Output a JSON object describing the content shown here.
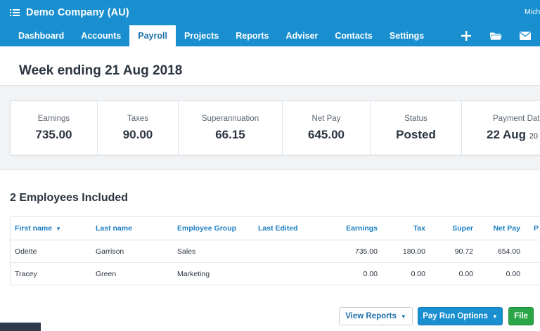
{
  "org": {
    "name": "Demo Company (AU)",
    "user": "Mich"
  },
  "nav": {
    "items": [
      "Dashboard",
      "Accounts",
      "Payroll",
      "Projects",
      "Reports",
      "Adviser",
      "Contacts",
      "Settings"
    ],
    "active": "Payroll",
    "icons": [
      "plus-icon",
      "folder-icon",
      "mail-icon"
    ]
  },
  "page": {
    "title": "Week ending 21 Aug 2018"
  },
  "summary": {
    "earnings": {
      "label": "Earnings",
      "value": "735.00"
    },
    "taxes": {
      "label": "Taxes",
      "value": "90.00"
    },
    "super": {
      "label": "Superannuation",
      "value": "66.15"
    },
    "net": {
      "label": "Net Pay",
      "value": "645.00"
    },
    "status": {
      "label": "Status",
      "value": "Posted"
    },
    "payment_date": {
      "label": "Payment Date",
      "value": "22 Aug",
      "year": "20"
    }
  },
  "employees": {
    "title": "2 Employees Included",
    "columns": {
      "first_name": "First name",
      "last_name": "Last name",
      "group": "Employee Group",
      "last_edited": "Last Edited",
      "earnings": "Earnings",
      "tax": "Tax",
      "super": "Super",
      "net_pay": "Net Pay",
      "more": "P"
    },
    "rows": [
      {
        "first_name": "Odette",
        "last_name": "Garrison",
        "group": "Sales",
        "last_edited": "",
        "earnings": "735.00",
        "tax": "180.00",
        "super": "90.72",
        "net_pay": "654.00"
      },
      {
        "first_name": "Tracey",
        "last_name": "Green",
        "group": "Marketing",
        "last_edited": "",
        "earnings": "0.00",
        "tax": "0.00",
        "super": "0.00",
        "net_pay": "0.00"
      }
    ]
  },
  "actions": {
    "view_reports": "View Reports",
    "pay_run_options": "Pay Run Options",
    "file": "File"
  },
  "colors": {
    "brand": "#1a8fcf",
    "link": "#1c7ec2",
    "success": "#2aa547"
  }
}
